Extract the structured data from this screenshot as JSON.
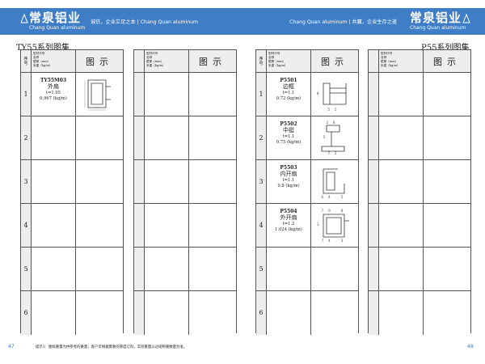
{
  "header": {
    "brand_cn": "常泉铝业",
    "brand_en": "Chang Quan aluminum",
    "slogan_left": "诚信，企业立足之本 | Chang Quan aluminum",
    "slogan_right": "Chang Quan aluminum | 共赢，企业生存之道"
  },
  "left_page": {
    "series_title": "TY55系列图集",
    "page_number": "47",
    "footer_note": "提示1：图样重量为供参考的重量，客户可根据需要的厚度订料，实际重量以过磅称重数量为准。"
  },
  "right_page": {
    "series_title": "P55系列图集",
    "page_number": "48"
  },
  "table_header": {
    "num_label_1": "序",
    "num_label_2": "号",
    "info_lines": [
      "型材代号",
      "名称",
      "壁厚（mm）",
      "米重（kg/m）"
    ],
    "figure_label": "图示"
  },
  "row_numbers": [
    "1",
    "2",
    "3",
    "4",
    "5",
    "6"
  ],
  "ty55_products": [
    {
      "code": "TY55M03",
      "name": "外扇",
      "thickness": "t=1.05",
      "weight": "0.967 (kg/m)"
    }
  ],
  "p55_products": [
    {
      "code": "P5501",
      "name": "边框",
      "thickness": "t=1.1",
      "weight": "0.72 (kg/m)",
      "dims": [
        "38",
        "55"
      ]
    },
    {
      "code": "P5502",
      "name": "中挺",
      "thickness": "t=1.1",
      "weight": "0.75 (kg/m)",
      "dims": [
        "28",
        "54.5",
        "72"
      ]
    },
    {
      "code": "P5503",
      "name": "内开扇",
      "thickness": "t=1.1",
      "weight": "0.8 (kg/m)",
      "dims": [
        "64.5"
      ]
    },
    {
      "code": "P5504",
      "name": "外开扇",
      "thickness": "t=1.2",
      "weight": "1.024 (kg/m)",
      "dims": [
        "70.8",
        "43",
        "74.3"
      ]
    }
  ],
  "colors": {
    "accent": "#3f7ec6",
    "header_cell": "#eeeeee",
    "border": "#555555"
  }
}
